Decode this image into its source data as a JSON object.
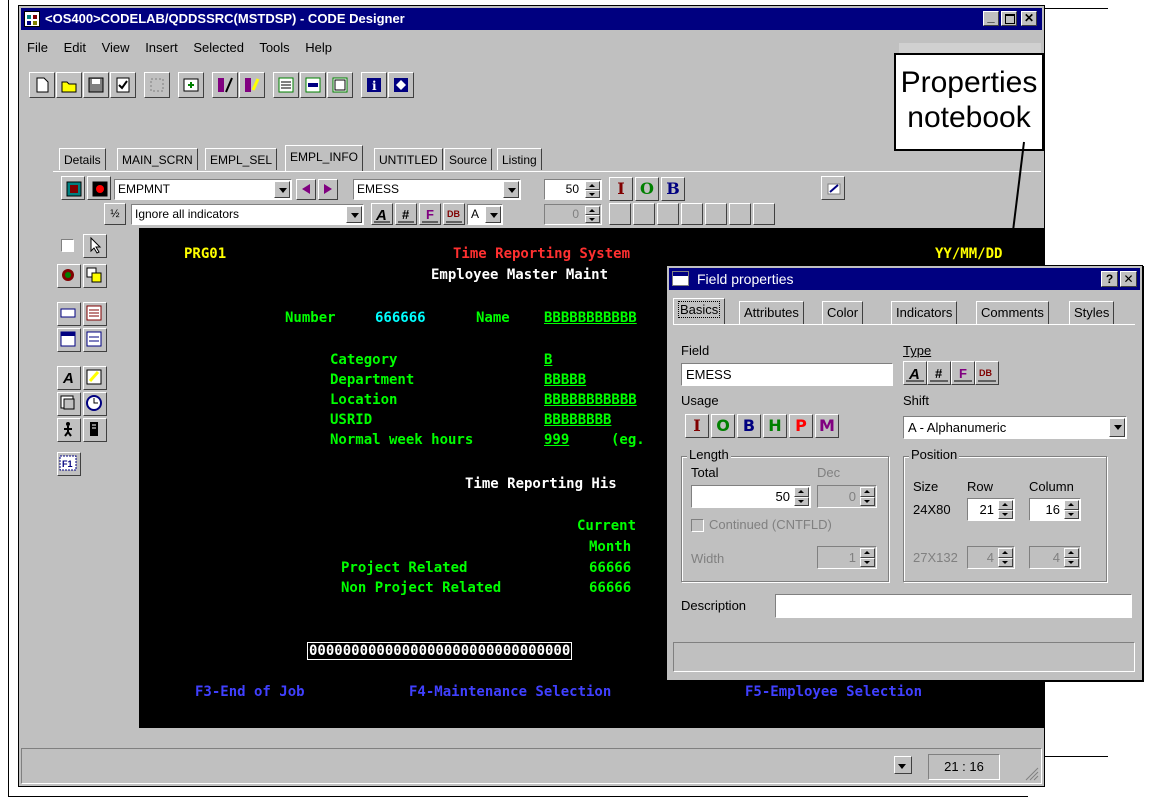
{
  "window": {
    "title": "<OS400>CODELAB/QDDSSRC(MSTDSP) - CODE Designer"
  },
  "menu": [
    "File",
    "Edit",
    "View",
    "Insert",
    "Selected",
    "Tools",
    "Help"
  ],
  "tabs": [
    "Details",
    "MAIN_SCRN",
    "EMPL_SEL",
    "EMPL_INFO",
    "UNTITLED",
    "Source",
    "Listing"
  ],
  "active_tab": "EMPL_INFO",
  "toolbar2": {
    "record_select": "EMPMNT",
    "field_select": "EMESS",
    "length_value": "50",
    "indicator_select": "Ignore all indicators",
    "type_letter": "A",
    "spin_value": "0"
  },
  "screen": {
    "program": "PRG01",
    "system_title": "Time Reporting System",
    "date_fmt": "YY/MM/DD",
    "subtitle": "Employee Master Maint",
    "number_label": "Number",
    "number_value": "666666",
    "name_label": "Name",
    "name_value": "BBBBBBBBBBB",
    "category_label": "Category",
    "category_value": "B",
    "department_label": "Department",
    "department_value": "BBBBB",
    "location_label": "Location",
    "location_value": "BBBBBBBBBBB",
    "usrid_label": "USRID",
    "usrid_value": "BBBBBBBB",
    "week_hours_label": "Normal week hours",
    "week_hours_value": "999",
    "week_hours_hint": "(eg.",
    "history_title": "Time Reporting His",
    "current_label": "Current",
    "month_label": "Month",
    "project_label": "Project Related",
    "project_value": "66666",
    "nonproject_label": "Non Project Related",
    "nonproject_value": "66666",
    "message_field": "0000000000000000000000000000000",
    "fkeys": [
      "F3-End of Job",
      "F4-Maintenance Selection",
      "F5-Employee Selection"
    ]
  },
  "status": {
    "position": "21 : 16"
  },
  "callout": {
    "line1": "Properties",
    "line2": "notebook"
  },
  "dialog": {
    "title": "Field properties",
    "tabs": [
      "Basics",
      "Attributes",
      "Color",
      "Indicators",
      "Comments",
      "Styles"
    ],
    "field_label": "Field",
    "field_value": "EMESS",
    "type_label": "Type",
    "usage_label": "Usage",
    "usage_buttons": [
      "I",
      "O",
      "B",
      "H",
      "P",
      "M"
    ],
    "shift_label": "Shift",
    "shift_value": "A - Alphanumeric",
    "length_group": "Length",
    "total_label": "Total",
    "dec_label": "Dec",
    "total_value": "50",
    "dec_value": "0",
    "continued_label": "Continued (CNTFLD)",
    "width_label": "Width",
    "width_value": "1",
    "position_group": "Position",
    "size_label": "Size",
    "row_label": "Row",
    "column_label": "Column",
    "size1": "24X80",
    "row1": "21",
    "col1": "16",
    "size2": "27X132",
    "row2": "4",
    "col2": "4",
    "description_label": "Description",
    "description_value": ""
  },
  "colors": {
    "titlebar": "#000080",
    "face": "#c0c0c0",
    "screen_bg": "#000000",
    "screen_green": "#00ff00"
  }
}
